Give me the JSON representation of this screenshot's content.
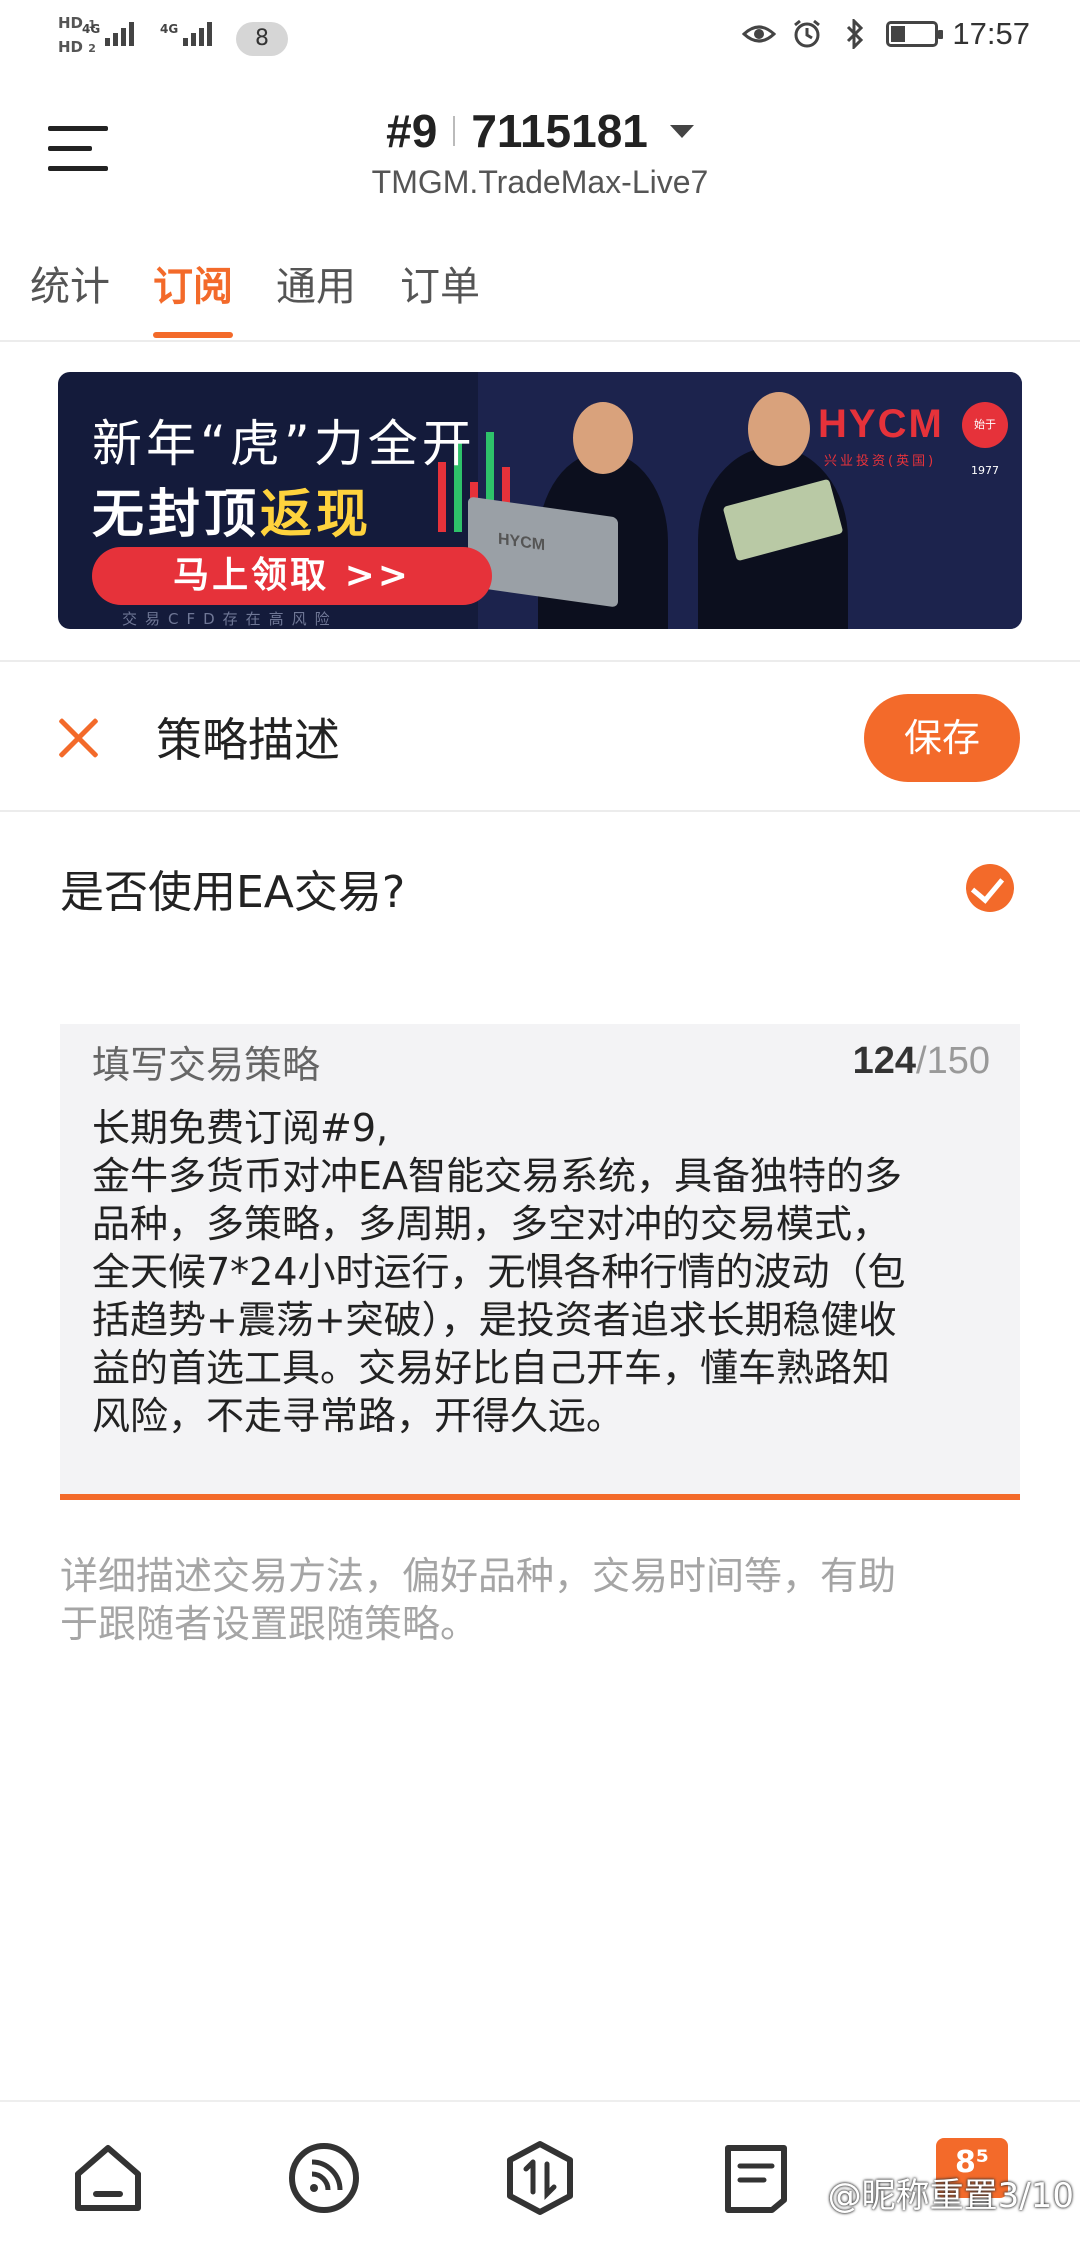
{
  "status_bar": {
    "hd1": "HD",
    "hd1_sub": "1",
    "hd2": "HD",
    "hd2_sub": "2",
    "net1": "4G",
    "net2": "4G",
    "badge": "8",
    "time": "17:57",
    "icons": [
      "eye-icon",
      "alarm-icon",
      "bluetooth-icon",
      "battery-icon"
    ]
  },
  "header": {
    "account_prefix": "#9",
    "account_number": "7115181",
    "server": "TMGM.TradeMax-Live7"
  },
  "tabs": [
    {
      "label": "统计",
      "active": false
    },
    {
      "label": "订阅",
      "active": true
    },
    {
      "label": "通用",
      "active": false
    },
    {
      "label": "订单",
      "active": false
    }
  ],
  "banner": {
    "line1": "新年“虎”力全开",
    "line2_a": "无封顶",
    "line2_b": "返现",
    "cta": "马上领取 >>",
    "risk_note": "交易CFD存在高风险",
    "brand": "HYCM",
    "brand_sub": "兴业投资(英国)",
    "seal": "始于1977",
    "laptop_brand": "HYCM"
  },
  "strategy": {
    "title": "策略描述",
    "save_label": "保存",
    "ea_question": "是否使用EA交易?",
    "ea_checked": true,
    "field_label": "填写交易策略",
    "count_current": "124",
    "count_max": "/150",
    "text_lines": [
      "长期免费订阅#9,",
      "金牛多货币对冲EA智能交易系统，具备独特的多",
      "品种，多策略，多周期，多空对冲的交易模式，",
      "全天候7*24小时运行，无惧各种行情的波动（包",
      "括趋势+震荡+突破），是投资者追求长期稳健收",
      "益的首选工具。交易好比自己开车，懂车熟路知",
      "风险，不走寻常路，开得久远。"
    ],
    "hint_lines": [
      "详细描述交易方法，偏好品种，交易时间等，有助",
      "于跟随者设置跟随策略。"
    ]
  },
  "bottom_nav": {
    "items": [
      "home-icon",
      "feed-icon",
      "trade-icon",
      "news-icon"
    ],
    "badge": "8⁵",
    "watermark": "@昵称重置3/10"
  },
  "colors": {
    "accent": "#f36a2a",
    "banner_bg": "#141b3b",
    "banner_red": "#e6323a",
    "banner_yellow": "#ffd33d"
  }
}
